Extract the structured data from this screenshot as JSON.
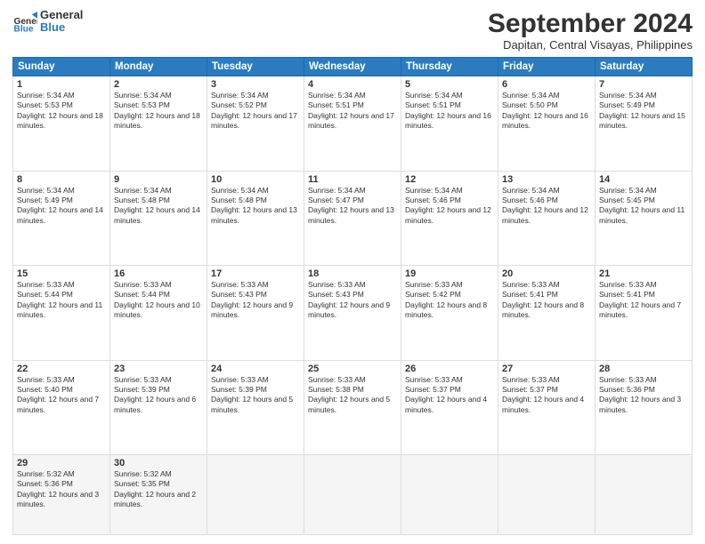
{
  "header": {
    "logo": {
      "line1": "General",
      "line2": "Blue"
    },
    "title": "September 2024",
    "subtitle": "Dapitan, Central Visayas, Philippines"
  },
  "weekdays": [
    "Sunday",
    "Monday",
    "Tuesday",
    "Wednesday",
    "Thursday",
    "Friday",
    "Saturday"
  ],
  "weeks": [
    [
      {
        "day": "1",
        "sunrise": "Sunrise: 5:34 AM",
        "sunset": "Sunset: 5:53 PM",
        "daylight": "Daylight: 12 hours and 18 minutes."
      },
      {
        "day": "2",
        "sunrise": "Sunrise: 5:34 AM",
        "sunset": "Sunset: 5:53 PM",
        "daylight": "Daylight: 12 hours and 18 minutes."
      },
      {
        "day": "3",
        "sunrise": "Sunrise: 5:34 AM",
        "sunset": "Sunset: 5:52 PM",
        "daylight": "Daylight: 12 hours and 17 minutes."
      },
      {
        "day": "4",
        "sunrise": "Sunrise: 5:34 AM",
        "sunset": "Sunset: 5:51 PM",
        "daylight": "Daylight: 12 hours and 17 minutes."
      },
      {
        "day": "5",
        "sunrise": "Sunrise: 5:34 AM",
        "sunset": "Sunset: 5:51 PM",
        "daylight": "Daylight: 12 hours and 16 minutes."
      },
      {
        "day": "6",
        "sunrise": "Sunrise: 5:34 AM",
        "sunset": "Sunset: 5:50 PM",
        "daylight": "Daylight: 12 hours and 16 minutes."
      },
      {
        "day": "7",
        "sunrise": "Sunrise: 5:34 AM",
        "sunset": "Sunset: 5:49 PM",
        "daylight": "Daylight: 12 hours and 15 minutes."
      }
    ],
    [
      {
        "day": "8",
        "sunrise": "Sunrise: 5:34 AM",
        "sunset": "Sunset: 5:49 PM",
        "daylight": "Daylight: 12 hours and 14 minutes."
      },
      {
        "day": "9",
        "sunrise": "Sunrise: 5:34 AM",
        "sunset": "Sunset: 5:48 PM",
        "daylight": "Daylight: 12 hours and 14 minutes."
      },
      {
        "day": "10",
        "sunrise": "Sunrise: 5:34 AM",
        "sunset": "Sunset: 5:48 PM",
        "daylight": "Daylight: 12 hours and 13 minutes."
      },
      {
        "day": "11",
        "sunrise": "Sunrise: 5:34 AM",
        "sunset": "Sunset: 5:47 PM",
        "daylight": "Daylight: 12 hours and 13 minutes."
      },
      {
        "day": "12",
        "sunrise": "Sunrise: 5:34 AM",
        "sunset": "Sunset: 5:46 PM",
        "daylight": "Daylight: 12 hours and 12 minutes."
      },
      {
        "day": "13",
        "sunrise": "Sunrise: 5:34 AM",
        "sunset": "Sunset: 5:46 PM",
        "daylight": "Daylight: 12 hours and 12 minutes."
      },
      {
        "day": "14",
        "sunrise": "Sunrise: 5:34 AM",
        "sunset": "Sunset: 5:45 PM",
        "daylight": "Daylight: 12 hours and 11 minutes."
      }
    ],
    [
      {
        "day": "15",
        "sunrise": "Sunrise: 5:33 AM",
        "sunset": "Sunset: 5:44 PM",
        "daylight": "Daylight: 12 hours and 11 minutes."
      },
      {
        "day": "16",
        "sunrise": "Sunrise: 5:33 AM",
        "sunset": "Sunset: 5:44 PM",
        "daylight": "Daylight: 12 hours and 10 minutes."
      },
      {
        "day": "17",
        "sunrise": "Sunrise: 5:33 AM",
        "sunset": "Sunset: 5:43 PM",
        "daylight": "Daylight: 12 hours and 9 minutes."
      },
      {
        "day": "18",
        "sunrise": "Sunrise: 5:33 AM",
        "sunset": "Sunset: 5:43 PM",
        "daylight": "Daylight: 12 hours and 9 minutes."
      },
      {
        "day": "19",
        "sunrise": "Sunrise: 5:33 AM",
        "sunset": "Sunset: 5:42 PM",
        "daylight": "Daylight: 12 hours and 8 minutes."
      },
      {
        "day": "20",
        "sunrise": "Sunrise: 5:33 AM",
        "sunset": "Sunset: 5:41 PM",
        "daylight": "Daylight: 12 hours and 8 minutes."
      },
      {
        "day": "21",
        "sunrise": "Sunrise: 5:33 AM",
        "sunset": "Sunset: 5:41 PM",
        "daylight": "Daylight: 12 hours and 7 minutes."
      }
    ],
    [
      {
        "day": "22",
        "sunrise": "Sunrise: 5:33 AM",
        "sunset": "Sunset: 5:40 PM",
        "daylight": "Daylight: 12 hours and 7 minutes."
      },
      {
        "day": "23",
        "sunrise": "Sunrise: 5:33 AM",
        "sunset": "Sunset: 5:39 PM",
        "daylight": "Daylight: 12 hours and 6 minutes."
      },
      {
        "day": "24",
        "sunrise": "Sunrise: 5:33 AM",
        "sunset": "Sunset: 5:39 PM",
        "daylight": "Daylight: 12 hours and 5 minutes."
      },
      {
        "day": "25",
        "sunrise": "Sunrise: 5:33 AM",
        "sunset": "Sunset: 5:38 PM",
        "daylight": "Daylight: 12 hours and 5 minutes."
      },
      {
        "day": "26",
        "sunrise": "Sunrise: 5:33 AM",
        "sunset": "Sunset: 5:37 PM",
        "daylight": "Daylight: 12 hours and 4 minutes."
      },
      {
        "day": "27",
        "sunrise": "Sunrise: 5:33 AM",
        "sunset": "Sunset: 5:37 PM",
        "daylight": "Daylight: 12 hours and 4 minutes."
      },
      {
        "day": "28",
        "sunrise": "Sunrise: 5:33 AM",
        "sunset": "Sunset: 5:36 PM",
        "daylight": "Daylight: 12 hours and 3 minutes."
      }
    ],
    [
      {
        "day": "29",
        "sunrise": "Sunrise: 5:32 AM",
        "sunset": "Sunset: 5:36 PM",
        "daylight": "Daylight: 12 hours and 3 minutes."
      },
      {
        "day": "30",
        "sunrise": "Sunrise: 5:32 AM",
        "sunset": "Sunset: 5:35 PM",
        "daylight": "Daylight: 12 hours and 2 minutes."
      },
      null,
      null,
      null,
      null,
      null
    ]
  ]
}
